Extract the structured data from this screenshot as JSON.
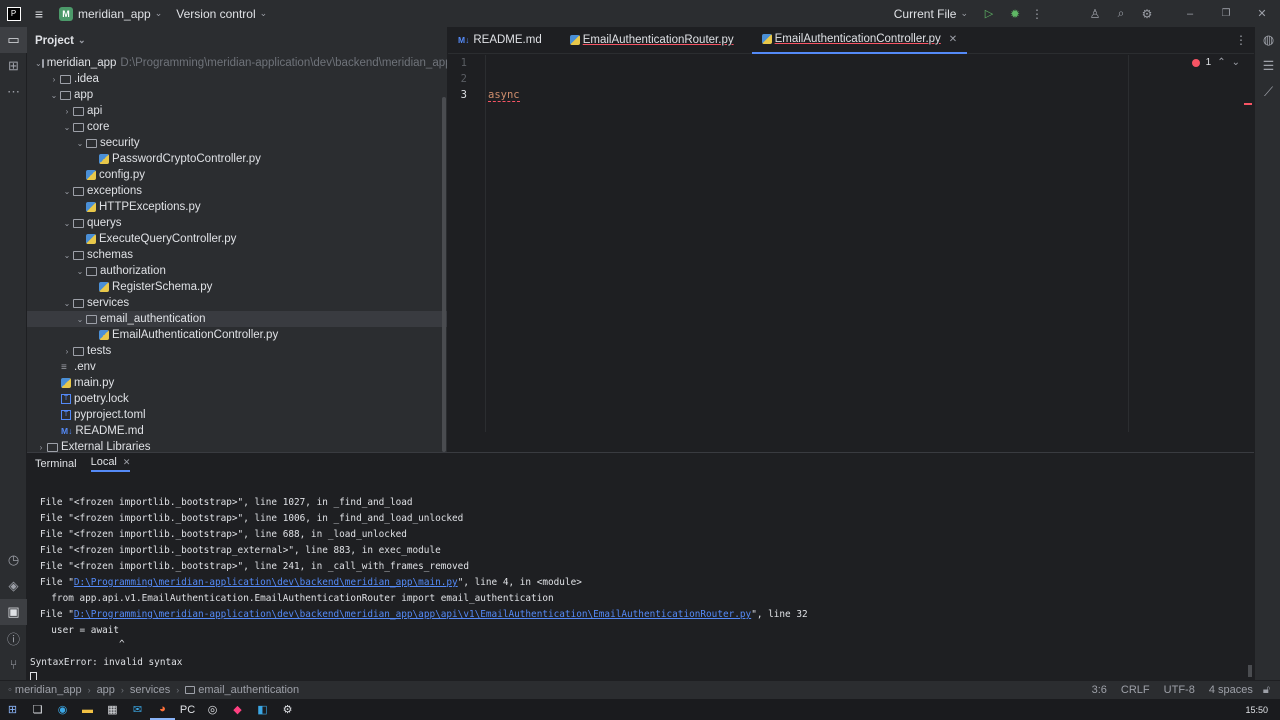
{
  "titlebar": {
    "project_initial": "M",
    "project_name": "meridian_app",
    "vcs": "Version control",
    "run_config": "Current File"
  },
  "project_panel": {
    "title": "Project",
    "root": {
      "name": "meridian_app",
      "path": "D:\\Programming\\meridian-application\\dev\\backend\\meridian_app"
    },
    "items": [
      {
        "label": ".idea"
      },
      {
        "label": "app"
      },
      {
        "label": "api"
      },
      {
        "label": "core"
      },
      {
        "label": "security"
      },
      {
        "label": "PasswordCryptoController.py"
      },
      {
        "label": "config.py"
      },
      {
        "label": "exceptions"
      },
      {
        "label": "HTTPExceptions.py"
      },
      {
        "label": "querys"
      },
      {
        "label": "ExecuteQueryController.py"
      },
      {
        "label": "schemas"
      },
      {
        "label": "authorization"
      },
      {
        "label": "RegisterSchema.py"
      },
      {
        "label": "services"
      },
      {
        "label": "email_authentication"
      },
      {
        "label": "EmailAuthenticationController.py"
      },
      {
        "label": "tests"
      },
      {
        "label": ".env"
      },
      {
        "label": "main.py"
      },
      {
        "label": "poetry.lock"
      },
      {
        "label": "pyproject.toml"
      },
      {
        "label": "README.md"
      },
      {
        "label": "External Libraries"
      }
    ]
  },
  "editor": {
    "tabs": [
      {
        "label": "README.md",
        "icon": "M↓"
      },
      {
        "label": "EmailAuthenticationRouter.py"
      },
      {
        "label": "EmailAuthenticationController.py"
      }
    ],
    "line_numbers": [
      "1",
      "2",
      "3"
    ],
    "code": [
      "",
      "",
      "async"
    ],
    "error_count": "1"
  },
  "terminal": {
    "tabs": [
      "Terminal",
      "Local"
    ],
    "lines": [
      "File \"<frozen importlib._bootstrap>\", line 1027, in _find_and_load",
      "File \"<frozen importlib._bootstrap>\", line 1006, in _find_and_load_unlocked",
      "File \"<frozen importlib._bootstrap>\", line 688, in _load_unlocked",
      "File \"<frozen importlib._bootstrap_external>\", line 883, in exec_module",
      "File \"<frozen importlib._bootstrap>\", line 241, in _call_with_frames_removed"
    ],
    "main_line": {
      "prefix": "File \"",
      "link": "D:\\Programming\\meridian-application\\dev\\backend\\meridian_app\\main.py",
      "suffix": "\", line 4, in <module>"
    },
    "import_line": "  from app.api.v1.EmailAuthentication.EmailAuthenticationRouter import email_authentication",
    "router_line": {
      "prefix": "File \"",
      "link": "D:\\Programming\\meridian-application\\dev\\backend\\meridian_app\\app\\api\\v1\\EmailAuthentication\\EmailAuthenticationRouter.py",
      "suffix": "\", line 32"
    },
    "code_line": "  user = await",
    "caret_line": "              ^",
    "error_line": "SyntaxError: invalid syntax"
  },
  "statusbar": {
    "crumbs": [
      "meridian_app",
      "app",
      "services",
      "email_authentication"
    ],
    "position": "3:6",
    "line_ending": "CRLF",
    "encoding": "UTF-8",
    "indent": "4 spaces"
  },
  "taskbar": {
    "clock": "15:50"
  },
  "colors": {
    "accent": "#548af7",
    "error": "#f75464",
    "keyword": "#cf8e6d",
    "panel": "#2b2d30",
    "editor_bg": "#1e1f22"
  }
}
